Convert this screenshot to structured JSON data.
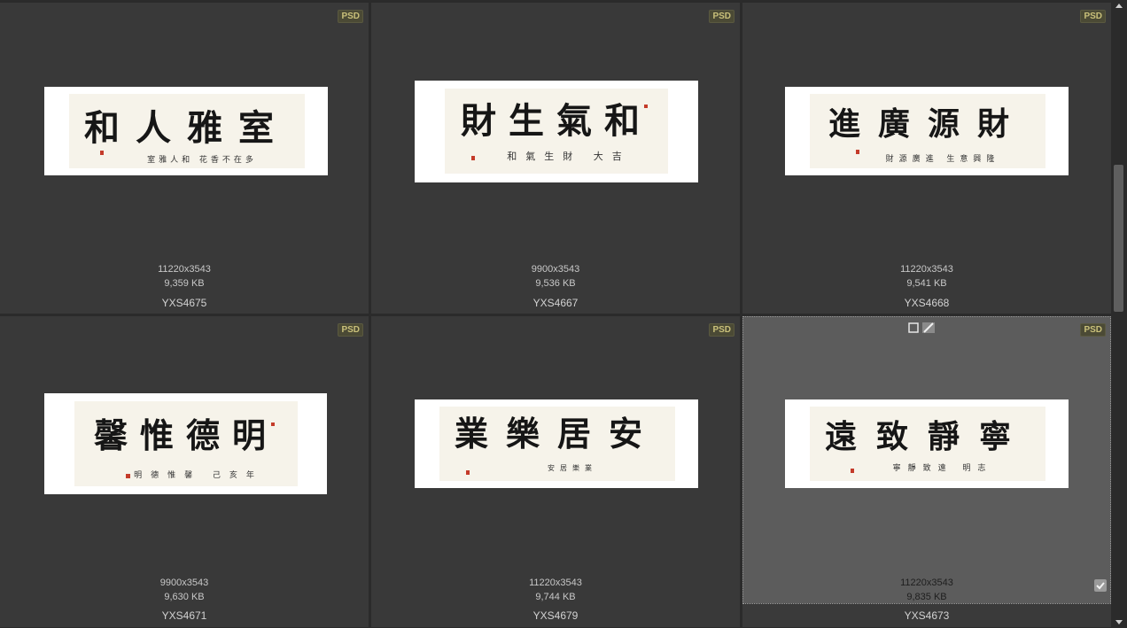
{
  "items": [
    {
      "badge": "PSD",
      "dims": "11220x3543",
      "size": "9,359 KB",
      "name": "YXS4675",
      "title": "和人雅室",
      "inscription": "室雅人和 花香不在多"
    },
    {
      "badge": "PSD",
      "dims": "9900x3543",
      "size": "9,536 KB",
      "name": "YXS4667",
      "title": "財生氣和",
      "inscription": "和氣生財 大吉"
    },
    {
      "badge": "PSD",
      "dims": "11220x3543",
      "size": "9,541 KB",
      "name": "YXS4668",
      "title": "進廣源財",
      "inscription": "財源廣進 生意興隆"
    },
    {
      "badge": "PSD",
      "dims": "9900x3543",
      "size": "9,630 KB",
      "name": "YXS4671",
      "title": "馨惟德明",
      "inscription": "明德惟馨 己亥年"
    },
    {
      "badge": "PSD",
      "dims": "11220x3543",
      "size": "9,744 KB",
      "name": "YXS4679",
      "title": "業樂居安",
      "inscription": "安居樂業"
    },
    {
      "badge": "PSD",
      "dims": "11220x3543",
      "size": "9,835 KB",
      "name": "YXS4673",
      "title": "遠致靜寧",
      "inscription": "寧靜致遠 明志"
    }
  ],
  "icons": {
    "select_box": "square-icon",
    "edit": "pencil-icon",
    "check": "checkmark-icon",
    "scroll_up": "chevron-up-icon",
    "scroll_down": "chevron-down-icon"
  },
  "colors": {
    "cell_bg": "#393939",
    "selected_bg": "#5c5c5c",
    "badge_text": "#c9c07a"
  }
}
